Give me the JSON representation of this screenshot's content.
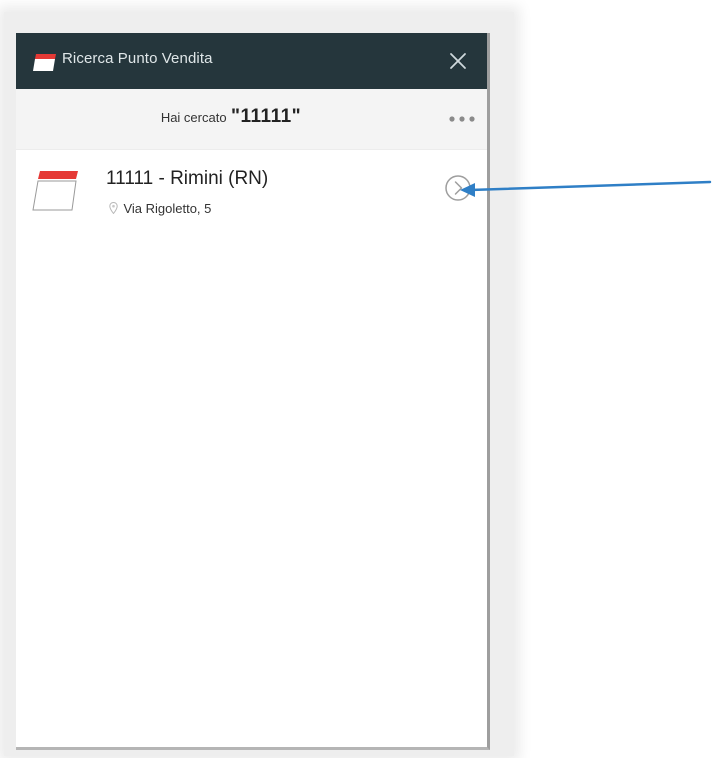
{
  "header": {
    "title": "Ricerca Punto Vendita",
    "logo_icon": "store-calendar-icon",
    "close_icon": "close-icon",
    "background_color": "#25363c"
  },
  "search": {
    "prefix": "Hai cercato",
    "query": "\"11111\"",
    "more_icon": "more-dots-icon"
  },
  "results": [
    {
      "name": "11111 - Rimini (RN)",
      "address": "Via Rigoletto, 5",
      "icon": "store-calendar-icon",
      "action_icon": "chevron-right-circle-icon"
    }
  ],
  "colors": {
    "brand_red": "#e53935",
    "annotation_arrow": "#2f7fc6"
  }
}
